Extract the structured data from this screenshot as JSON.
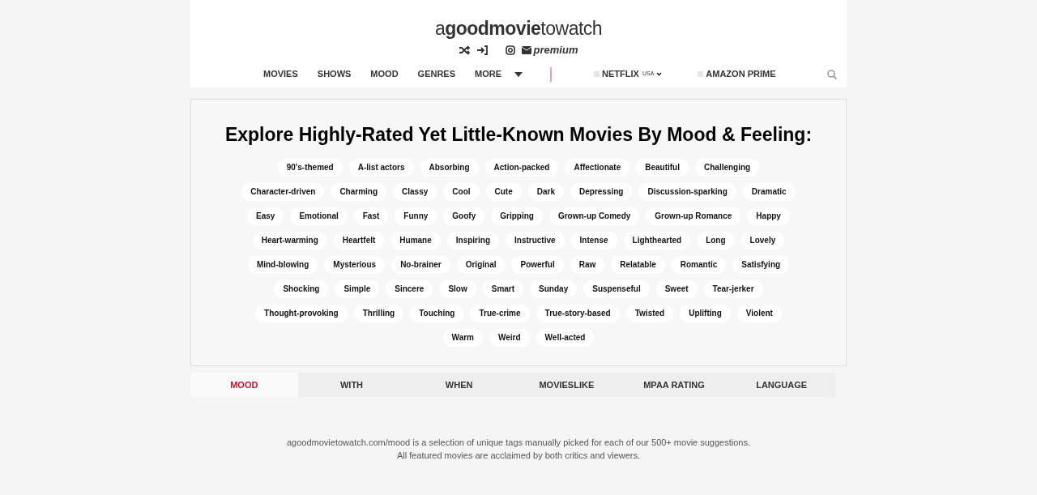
{
  "header": {
    "logo": "a**goodmovie**towatch",
    "premium": "premium"
  },
  "nav": {
    "items": [
      "MOVIES",
      "SHOWS",
      "MOOD",
      "GENRES",
      "MORE"
    ],
    "services": [
      {
        "label": "NETFLIX",
        "region": "USA",
        "checked": false
      },
      {
        "label": "AMAZON PRIME",
        "checked": false
      }
    ]
  },
  "main": {
    "title": "Explore Highly-Rated Yet Little-Known Movies By Mood & Feeling:",
    "tags": [
      "90's-themed",
      "A-list actors",
      "Absorbing",
      "Action-packed",
      "Affectionate",
      "Beautiful",
      "Challenging",
      "Character-driven",
      "Charming",
      "Classy",
      "Cool",
      "Cute",
      "Dark",
      "Depressing",
      "Discussion-sparking",
      "Dramatic",
      "Easy",
      "Emotional",
      "Fast",
      "Funny",
      "Goofy",
      "Gripping",
      "Grown-up Comedy",
      "Grown-up Romance",
      "Happy",
      "Heart-warming",
      "Heartfelt",
      "Humane",
      "Inspiring",
      "Instructive",
      "Intense",
      "Lighthearted",
      "Long",
      "Lovely",
      "Mind-blowing",
      "Mysterious",
      "No-brainer",
      "Original",
      "Powerful",
      "Raw",
      "Relatable",
      "Romantic",
      "Satisfying",
      "Shocking",
      "Simple",
      "Sincere",
      "Slow",
      "Smart",
      "Sunday",
      "Suspenseful",
      "Sweet",
      "Tear-jerker",
      "Thought-provoking",
      "Thrilling",
      "Touching",
      "True-crime",
      "True-story-based",
      "Twisted",
      "Uplifting",
      "Violent",
      "Warm",
      "Weird",
      "Well-acted"
    ]
  },
  "tabs": [
    {
      "label": "MOOD",
      "selected": true
    },
    {
      "label": "WITH",
      "selected": false
    },
    {
      "label": "WHEN",
      "selected": false
    },
    {
      "label": "MOVIESLIKE",
      "selected": false
    },
    {
      "label": "MPAA RATING",
      "selected": false
    },
    {
      "label": "LANGUAGE",
      "selected": false
    }
  ],
  "footer": [
    "agoodmovietowatch.com/mood is a selection of unique tags manually picked for each of our 500+ movie suggestions.",
    "All featured movies are acclaimed by both critics and viewers."
  ]
}
